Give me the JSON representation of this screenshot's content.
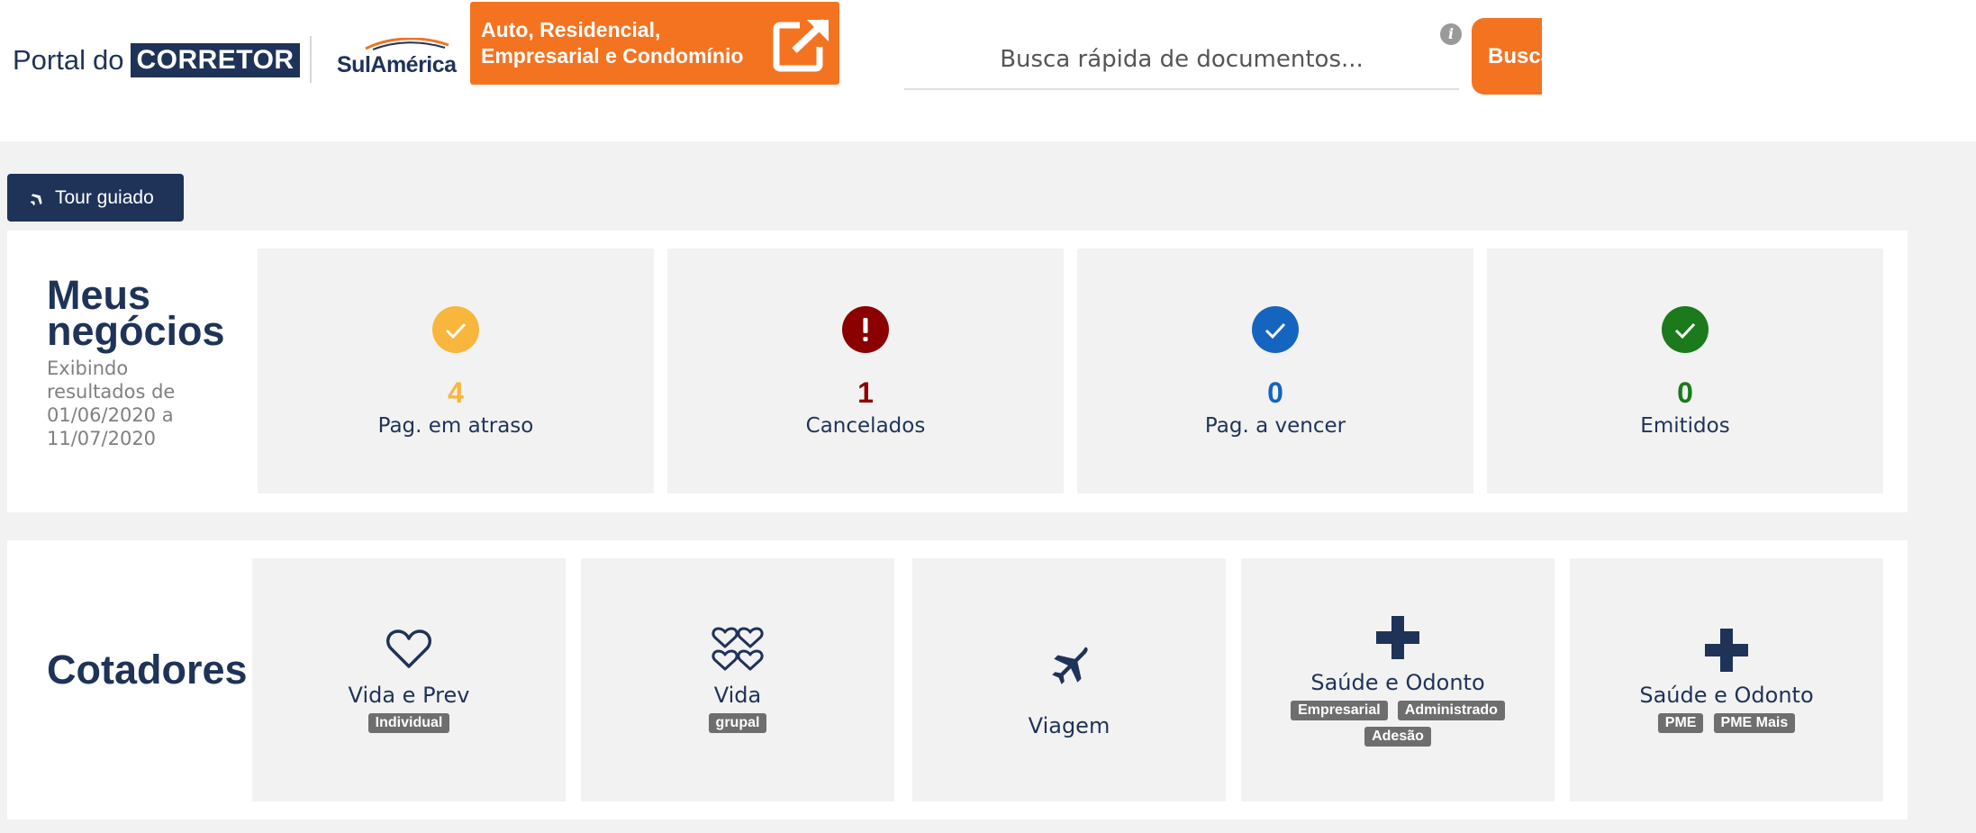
{
  "header": {
    "brand": {
      "portal": "Portal",
      "do": "do",
      "corretor": "CORRETOR"
    },
    "partner_logo": "SulAmérica",
    "external_link": {
      "line1": "Auto, Residencial,",
      "line2": "Empresarial e Condomínio",
      "icon": "external-link-icon"
    },
    "search": {
      "placeholder": "Busca rápida de documentos...",
      "value": "",
      "button_label": "Busca",
      "info_icon": "info-icon"
    }
  },
  "tour_button": {
    "label": "Tour guiado",
    "icon": "plane-icon"
  },
  "meus_negocios": {
    "title_line1": "Meus",
    "title_line2": "negócios",
    "subtitle": "Exibindo resultados de 01/06/2020 a 11/07/2020",
    "cards": [
      {
        "count": "4",
        "label": "Pag. em atraso",
        "icon": "check-circle-icon",
        "color": "#f9b63c"
      },
      {
        "count": "1",
        "label": "Cancelados",
        "icon": "exclamation-circle-icon",
        "color": "#8b0000"
      },
      {
        "count": "0",
        "label": "Pag. a vencer",
        "icon": "check-circle-icon",
        "color": "#1565c0"
      },
      {
        "count": "0",
        "label": "Emitidos",
        "icon": "check-circle-icon",
        "color": "#1b7a1b"
      }
    ]
  },
  "cotadores": {
    "title": "Cotadores",
    "items": [
      {
        "name": "Vida e Prev",
        "icon": "heart-outline-icon",
        "tags": [
          "Individual"
        ]
      },
      {
        "name": "Vida",
        "icon": "group-hearts-icon",
        "tags": [
          "grupal"
        ]
      },
      {
        "name": "Viagem",
        "icon": "airplane-icon",
        "tags": []
      },
      {
        "name": "Saúde e Odonto",
        "icon": "medical-cross-icon",
        "tags": [
          "Empresarial",
          "Administrado",
          "Adesão"
        ]
      },
      {
        "name": "Saúde e Odonto",
        "icon": "medical-cross-icon",
        "tags": [
          "PME",
          "PME Mais"
        ]
      }
    ]
  },
  "colors": {
    "primary_navy": "#1f3358",
    "accent_orange": "#f47321",
    "card_bg": "#f2f2f2",
    "page_bg": "#f2f2f2"
  }
}
